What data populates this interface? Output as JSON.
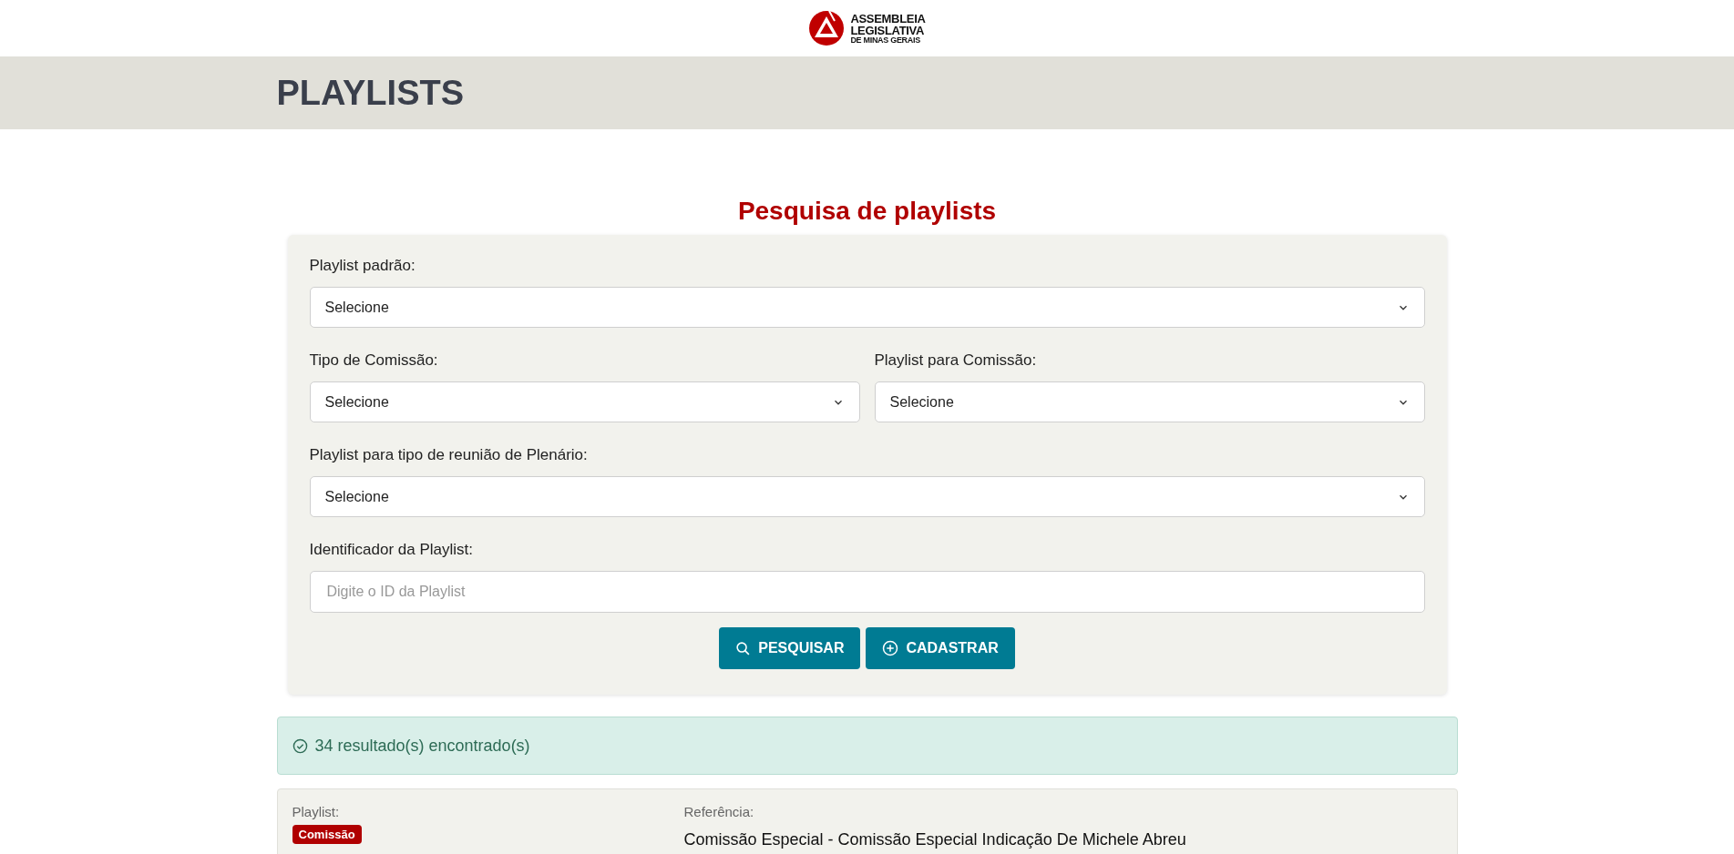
{
  "logo": {
    "lines": [
      "ASSEMBLEIA",
      "LEGISLATIVA",
      "DE MINAS GERAIS"
    ]
  },
  "page_title": "PLAYLISTS",
  "search_form": {
    "heading": "Pesquisa de playlists",
    "field_rows": [
      [
        {
          "kind": "select",
          "label": "Playlist padrão:",
          "value": "Selecione"
        }
      ],
      [
        {
          "kind": "select",
          "label": "Tipo de Comissão:",
          "value": "Selecione"
        },
        {
          "kind": "select",
          "label": "Playlist para Comissão:",
          "value": "Selecione"
        }
      ],
      [
        {
          "kind": "select",
          "label": "Playlist para tipo de reunião de Plenário:",
          "value": "Selecione"
        }
      ],
      [
        {
          "kind": "text",
          "label": "Identificador da Playlist:",
          "placeholder": "Digite o ID da Playlist"
        }
      ]
    ],
    "buttons": [
      {
        "kind": "search",
        "label": "PESQUISAR"
      },
      {
        "kind": "add",
        "label": "CADASTRAR"
      }
    ]
  },
  "result_alert": "34 resultado(s) encontrado(s)",
  "results": [
    {
      "playlist_label": "Playlist:",
      "tag": "Comissão",
      "color": "#b00000",
      "reference_label": "Referência:",
      "reference": "Comissão Especial - Comissão Especial Indicação De Michele Abreu"
    }
  ]
}
